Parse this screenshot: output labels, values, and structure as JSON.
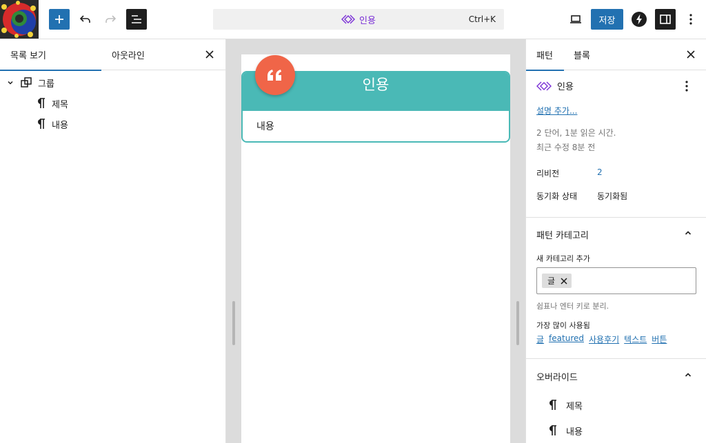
{
  "colors": {
    "accent": "#2271b1",
    "pattern_purple": "#7a2fd6",
    "quote_teal": "#4ab9b6",
    "quote_badge": "#f06548"
  },
  "topbar": {
    "add_icon": "plus-icon",
    "undo_icon": "undo-icon",
    "redo_icon": "redo-icon",
    "list_view_icon": "list-view-icon",
    "command_title": "인용",
    "command_shortcut": "Ctrl+K",
    "preview_icon": "desktop-icon",
    "save_label": "저장",
    "plugin_icon": "bolt-icon",
    "settings_icon": "sidebar-toggle-icon",
    "options_icon": "kebab-icon"
  },
  "left_panel": {
    "tabs": [
      "목록 보기",
      "아웃라인"
    ],
    "tree": [
      {
        "label": "그룹",
        "icon": "group-icon"
      },
      {
        "label": "제목",
        "icon": "paragraph-icon"
      },
      {
        "label": "내용",
        "icon": "paragraph-icon"
      }
    ]
  },
  "canvas": {
    "quote_title": "인용",
    "quote_content": "내용",
    "badge_glyph": "“"
  },
  "right_panel": {
    "tabs": [
      "패턴",
      "블록"
    ],
    "pattern_name": "인용",
    "add_description": "설명 추가...",
    "stats_line1": "2 단어, 1분 읽은 시간.",
    "stats_line2": "최근 수정 8분 전",
    "revisions_label": "리비전",
    "revisions_value": "2",
    "sync_label": "동기화 상태",
    "sync_value": "동기화됨",
    "categories_title": "패턴 카테고리",
    "new_category_label": "새 카테고리 추가",
    "category_token": "글",
    "category_help": "쉼표나 엔터 키로 분리.",
    "most_used_label": "가장 많이 사용됨",
    "most_used": [
      "글",
      "featured",
      "사용후기",
      "텍스트",
      "버튼"
    ],
    "overrides_title": "오버라이드",
    "overrides": [
      "제목",
      "내용"
    ]
  }
}
